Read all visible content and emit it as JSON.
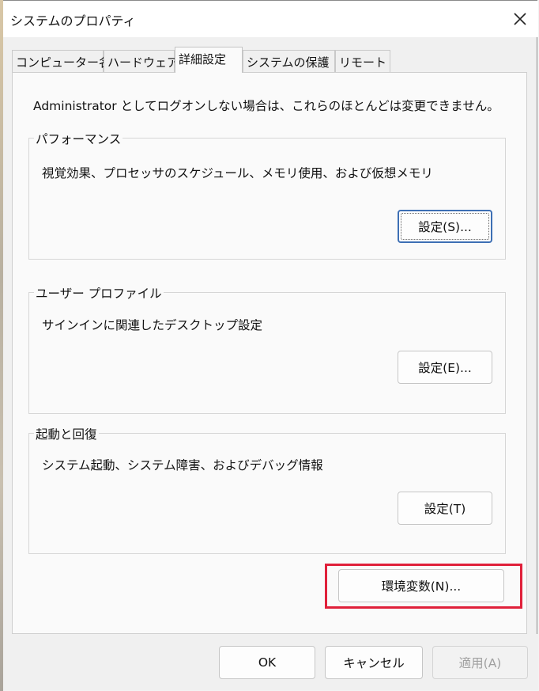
{
  "window": {
    "title": "システムのプロパティ"
  },
  "tabs": [
    {
      "label": "コンピューター名"
    },
    {
      "label": "ハードウェア"
    },
    {
      "label": "詳細設定"
    },
    {
      "label": "システムの保護"
    },
    {
      "label": "リモート"
    }
  ],
  "active_tab": "詳細設定",
  "panel": {
    "note": "Administrator としてログオンしない場合は、これらのほとんどは変更できません。",
    "performance": {
      "title": "パフォーマンス",
      "description": "視覚効果、プロセッサのスケジュール、メモリ使用、および仮想メモリ",
      "button": "設定(S)..."
    },
    "user_profile": {
      "title": "ユーザー プロファイル",
      "description": "サインインに関連したデスクトップ設定",
      "button": "設定(E)..."
    },
    "startup_recovery": {
      "title": "起動と回復",
      "description": "システム起動、システム障害、およびデバッグ情報",
      "button": "設定(T)"
    },
    "env_button": "環境変数(N)..."
  },
  "footer": {
    "ok": "OK",
    "cancel": "キャンセル",
    "apply": "適用(A)"
  },
  "colors": {
    "highlight": "#e0203a",
    "focus": "#3d6fb4"
  }
}
